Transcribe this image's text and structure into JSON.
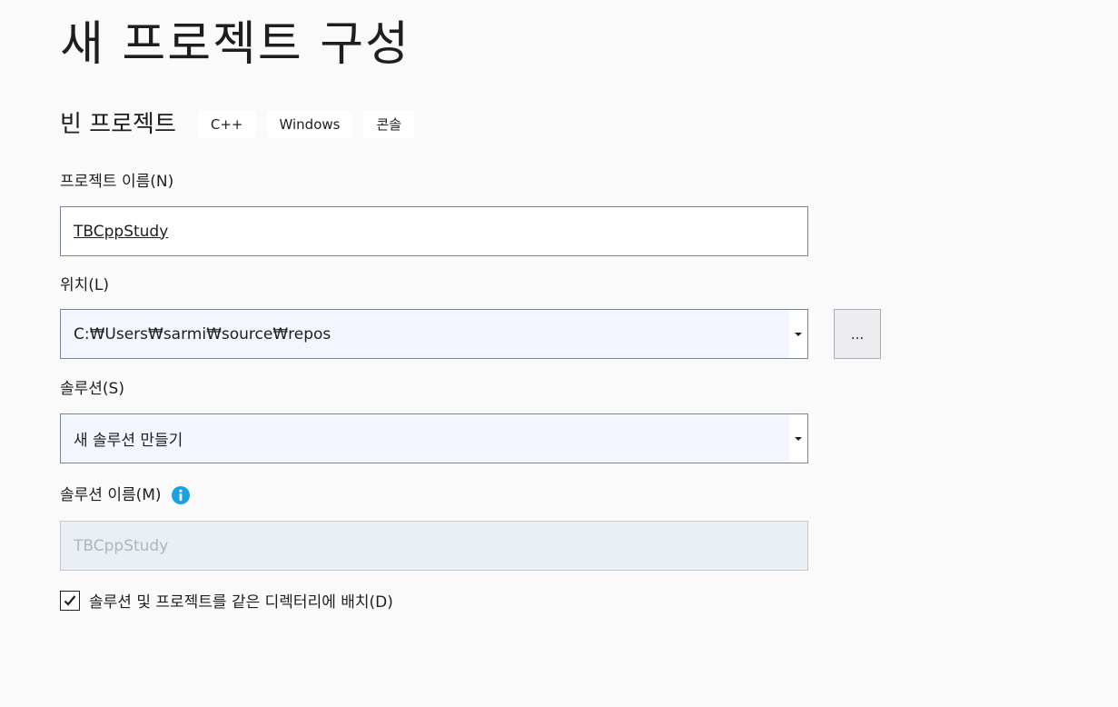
{
  "page": {
    "title": "새 프로젝트 구성"
  },
  "template": {
    "name": "빈 프로젝트",
    "tags": [
      "C++",
      "Windows",
      "콘솔"
    ]
  },
  "project_name": {
    "label": "프로젝트 이름(N)",
    "value": "TBCppStudy"
  },
  "location": {
    "label": "위치(L)",
    "value": "C:₩Users₩sarmi₩source₩repos",
    "browse_label": "..."
  },
  "solution": {
    "label": "솔루션(S)",
    "value": "새 솔루션 만들기"
  },
  "solution_name": {
    "label": "솔루션 이름(M)",
    "value": "TBCppStudy",
    "info_icon": "info-icon",
    "info_color": "#1ba1e2"
  },
  "same_directory": {
    "label": "솔루션 및 프로젝트를 같은 디렉터리에 배치(D)",
    "checked": true
  }
}
